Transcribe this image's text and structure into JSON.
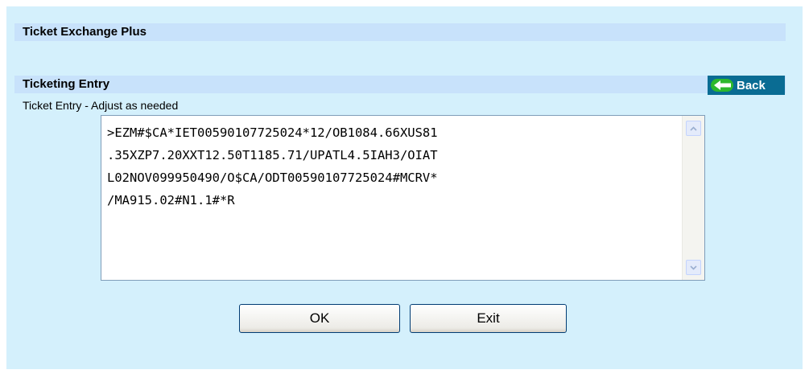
{
  "header": {
    "title": "Ticket Exchange Plus"
  },
  "section": {
    "title": "Ticketing Entry",
    "back_label": "Back",
    "subtitle": "Ticket Entry - Adjust as needed"
  },
  "ticket_entry": {
    "lines": [
      ">EZM#$CA*IET00590107725024*12/OB1084.66XUS81",
      ".35XZP7.20XXT12.50T1185.71/UPATL4.5IAH3/OIAT",
      "L02NOV099950490/O$CA/ODT00590107725024#MCRV*",
      "/MA915.02#N1.1#*R"
    ]
  },
  "buttons": {
    "ok_label": "OK",
    "exit_label": "Exit"
  },
  "icons": {
    "back": "back-arrow-icon",
    "scroll_up": "chevron-up-icon",
    "scroll_down": "chevron-down-icon"
  },
  "colors": {
    "panel_background": "#d4f0fc",
    "header_bar": "#c8e2fb",
    "back_button": "#0a6c93",
    "button_border": "#003c74"
  }
}
